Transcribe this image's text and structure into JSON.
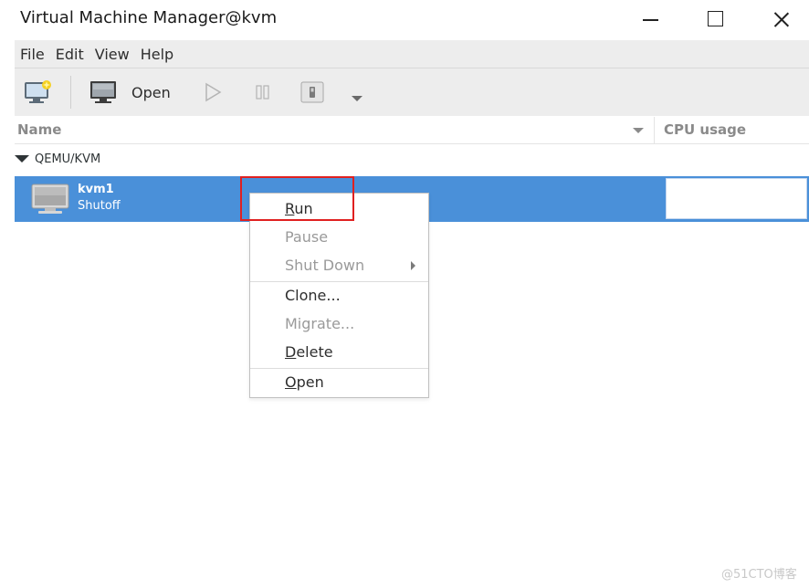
{
  "window": {
    "title": "Virtual Machine Manager@kvm"
  },
  "menubar": {
    "items": [
      "File",
      "Edit",
      "View",
      "Help"
    ]
  },
  "toolbar": {
    "open_label": "Open",
    "icons": [
      "new-vm-icon",
      "monitor-icon",
      "play-icon",
      "pause-icon",
      "shutdown-icon",
      "chevron-down-icon"
    ]
  },
  "list": {
    "columns": {
      "name": "Name",
      "cpu": "CPU usage"
    },
    "group": "QEMU/KVM",
    "vms": [
      {
        "name": "kvm1",
        "state": "Shutoff"
      }
    ]
  },
  "context_menu": {
    "items": [
      {
        "label_u": "R",
        "label_rest": "un",
        "enabled": true
      },
      {
        "label": "Pause",
        "enabled": false
      },
      {
        "label": "Shut Down",
        "enabled": false,
        "submenu": true
      },
      {
        "label": "Clone...",
        "enabled": true
      },
      {
        "label": "Migrate...",
        "enabled": false
      },
      {
        "label_u": "D",
        "label_rest": "elete",
        "enabled": true
      },
      {
        "label_u": "O",
        "label_rest": "pen",
        "enabled": true
      }
    ]
  },
  "colors": {
    "selection": "#4a90d9",
    "highlight_box": "#e02020",
    "toolbar_bg": "#ededed"
  },
  "watermark": "@51CTO博客"
}
